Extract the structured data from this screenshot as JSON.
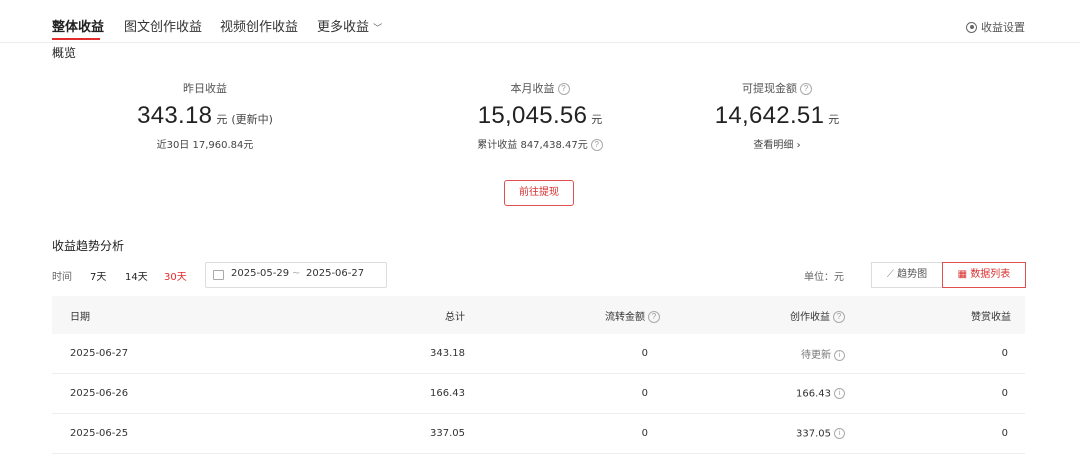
{
  "tabs": [
    {
      "label": "整体收益"
    },
    {
      "label": "图文创作收益"
    },
    {
      "label": "视频创作收益"
    },
    {
      "label": "更多收益"
    }
  ],
  "settings_label": "收益设置",
  "overview": {
    "title": "概览",
    "yesterday": {
      "label": "昨日收益",
      "value": "343.18",
      "unit": "元",
      "status": "(更新中)",
      "sub_label": "近30日",
      "sub_value": "17,960.84元"
    },
    "month": {
      "label": "本月收益",
      "value": "15,045.56",
      "unit": "元",
      "sub_label": "累计收益",
      "sub_value": "847,438.47元"
    },
    "withdrawable": {
      "label": "可提现金额",
      "value": "14,642.51",
      "unit": "元",
      "link": "查看明细"
    },
    "withdraw_button": "前往提现"
  },
  "trend": {
    "title": "收益趋势分析",
    "time_label": "时间",
    "ranges": [
      "7天",
      "14天",
      "30天"
    ],
    "date_start": "2025-05-29",
    "date_sep": "~",
    "date_end": "2025-06-27",
    "unit_label": "单位：元",
    "view_chart": "趋势图",
    "view_table": "数据列表"
  },
  "table": {
    "headers": [
      "日期",
      "总计",
      "流转金额",
      "创作收益",
      "赞赏收益"
    ],
    "rows": [
      {
        "date": "2025-06-27",
        "total": "343.18",
        "flow": "0",
        "creation": "待更新",
        "tips": "0"
      },
      {
        "date": "2025-06-26",
        "total": "166.43",
        "flow": "0",
        "creation": "166.43",
        "tips": "0"
      },
      {
        "date": "2025-06-25",
        "total": "337.05",
        "flow": "0",
        "creation": "337.05",
        "tips": "0"
      }
    ]
  },
  "colors": {
    "accent": "#e22b2b"
  }
}
